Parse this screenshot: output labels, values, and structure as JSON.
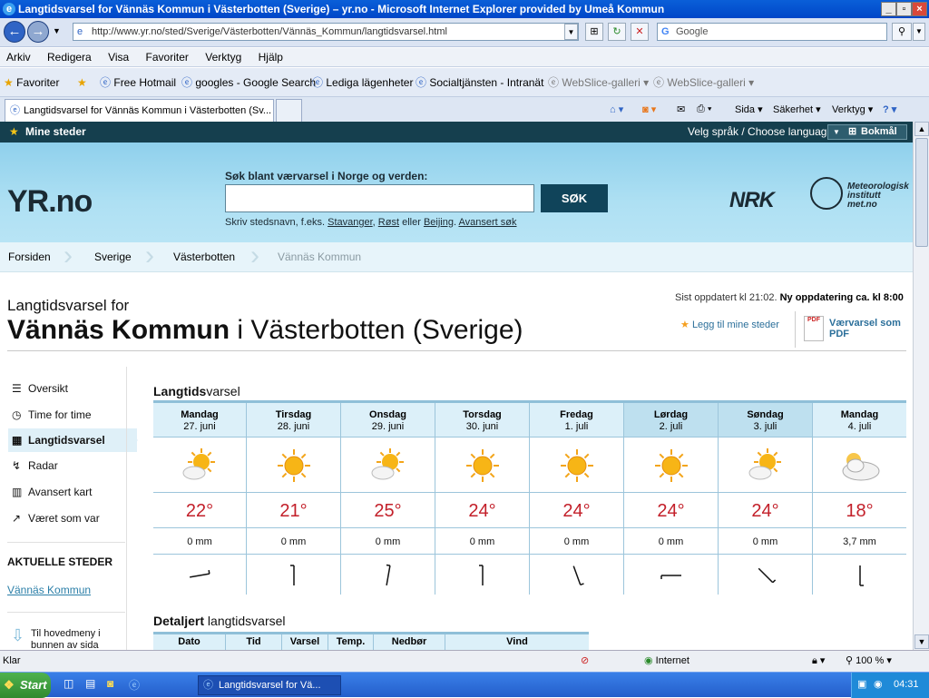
{
  "window": {
    "title": "Langtidsvarsel for Vännäs Kommun i Västerbotten (Sverige) – yr.no - Microsoft Internet Explorer provided by Umeå Kommun",
    "address": "http://www.yr.no/sted/Sverige/Västerbotten/Vännäs_Kommun/langtidsvarsel.html",
    "search_placeholder": "Google"
  },
  "menu": [
    "Arkiv",
    "Redigera",
    "Visa",
    "Favoriter",
    "Verktyg",
    "Hjälp"
  ],
  "favorites": {
    "label": "Favoriter",
    "items": [
      "Free Hotmail",
      "googles - Google Search",
      "Lediga lägenheter",
      "Socialtjänsten - Intranät",
      "WebSlice-galleri",
      "WebSlice-galleri"
    ]
  },
  "tab": {
    "title": "Langtidsvarsel for Vännäs Kommun i Västerbotten (Sv..."
  },
  "commandbar": {
    "sida": "Sida",
    "sakerhet": "Säkerhet",
    "verktyg": "Verktyg"
  },
  "site": {
    "mine_steder": "Mine steder",
    "language_label": "Velg språk / Choose language:",
    "language_value": "Bokmål",
    "logo": "YR.no",
    "search_label": "Søk blant værvarsel i Norge og verden:",
    "search_button": "SØK",
    "hint_prefix": "Skriv stedsnavn, f.eks.",
    "hint_ex1": "Stavanger",
    "hint_ex2": "Røst",
    "hint_or": "eller",
    "hint_ex3": "Beijing",
    "hint_adv": "Avansert søk",
    "nrk": "NRK",
    "met_line1": "Meteorologisk",
    "met_line2": "institutt",
    "met_line3": "met.no"
  },
  "breadcrumb": [
    "Forsiden",
    "Sverige",
    "Västerbotten",
    "Vännäs Kommun"
  ],
  "heading": {
    "small": "Langtidsvarsel for",
    "place": "Vännäs Kommun",
    "rest": " i Västerbotten (Sverige)",
    "updated": "Sist oppdatert kl 21:02.",
    "next_update": "Ny oppdatering ca. kl 8:00",
    "add_fav": "Legg til mine steder",
    "pdf_line1": "Værvarsel som",
    "pdf_line2": "PDF"
  },
  "leftnav": [
    {
      "label": "Oversikt",
      "icon": "list-icon"
    },
    {
      "label": "Time for time",
      "icon": "clock-icon"
    },
    {
      "label": "Langtidsvarsel",
      "icon": "calendar-icon"
    },
    {
      "label": "Radar",
      "icon": "radar-icon"
    },
    {
      "label": "Avansert kart",
      "icon": "map-icon"
    },
    {
      "label": "Været som var",
      "icon": "chart-icon"
    }
  ],
  "aktuelle": {
    "title": "AKTUELLE STEDER",
    "link": "Vännäs Kommun"
  },
  "back_to_menu": {
    "line1": "Til hovedmeny i",
    "line2": "bunnen av sida"
  },
  "forecast": {
    "title_bold": "Langtids",
    "title_rest": "varsel",
    "days": [
      {
        "day": "Mandag",
        "date": "27. juni",
        "icon": "partly-cloudy",
        "temp": "22°",
        "prec": "0 mm",
        "wind_deg": 80
      },
      {
        "day": "Tirsdag",
        "date": "28. juni",
        "icon": "sun",
        "temp": "21°",
        "prec": "0 mm",
        "wind_deg": 0
      },
      {
        "day": "Onsdag",
        "date": "29. juni",
        "icon": "partly-cloudy",
        "temp": "25°",
        "prec": "0 mm",
        "wind_deg": 10
      },
      {
        "day": "Torsdag",
        "date": "30. juni",
        "icon": "sun",
        "temp": "24°",
        "prec": "0 mm",
        "wind_deg": 0
      },
      {
        "day": "Fredag",
        "date": "1. juli",
        "icon": "sun",
        "temp": "24°",
        "prec": "0 mm",
        "wind_deg": 160
      },
      {
        "day": "Lørdag",
        "date": "2. juli",
        "icon": "sun",
        "temp": "24°",
        "prec": "0 mm",
        "wind_deg": 270
      },
      {
        "day": "Søndag",
        "date": "3. juli",
        "icon": "partly-cloudy",
        "temp": "24°",
        "prec": "0 mm",
        "wind_deg": 135
      },
      {
        "day": "Mandag",
        "date": "4. juli",
        "icon": "cloudy-sun",
        "temp": "18°",
        "prec": "3,7 mm",
        "wind_deg": 180
      }
    ]
  },
  "detail": {
    "title_bold": "Detaljert",
    "title_rest": " langtidsvarsel",
    "headers": [
      "Dato",
      "Tid",
      "Varsel",
      "Temp.",
      "Nedbør",
      "Vind"
    ]
  },
  "status": {
    "text": "Klar",
    "zone": "Internet",
    "zoom": "100 %"
  },
  "taskbar": {
    "start": "Start",
    "item": "Langtidsvarsel for Vä...",
    "clock": "04:31"
  },
  "colors": {
    "temp": "#c3202a",
    "header_dark": "#153f4e",
    "link": "#2b7fa8"
  }
}
